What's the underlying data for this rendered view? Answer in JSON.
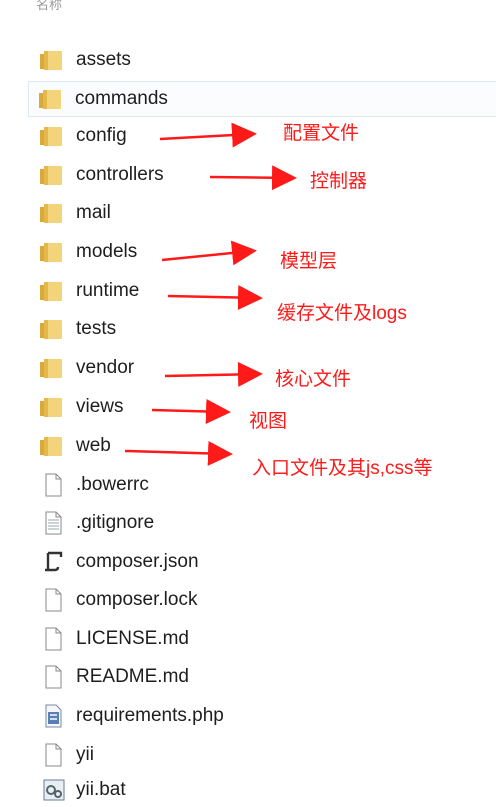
{
  "header": {
    "text": "名称"
  },
  "files": [
    {
      "name": "assets",
      "icon": "folder-icon"
    },
    {
      "name": "commands",
      "icon": "folder-icon"
    },
    {
      "name": "config",
      "icon": "folder-icon"
    },
    {
      "name": "controllers",
      "icon": "folder-icon"
    },
    {
      "name": "mail",
      "icon": "folder-icon"
    },
    {
      "name": "models",
      "icon": "folder-icon"
    },
    {
      "name": "runtime",
      "icon": "folder-icon"
    },
    {
      "name": "tests",
      "icon": "folder-icon"
    },
    {
      "name": "vendor",
      "icon": "folder-icon"
    },
    {
      "name": "views",
      "icon": "folder-icon"
    },
    {
      "name": "web",
      "icon": "folder-icon"
    },
    {
      "name": ".bowerrc",
      "icon": "blank-file-icon"
    },
    {
      "name": ".gitignore",
      "icon": "text-file-icon"
    },
    {
      "name": "composer.json",
      "icon": "script-file-icon"
    },
    {
      "name": "composer.lock",
      "icon": "blank-file-icon"
    },
    {
      "name": "LICENSE.md",
      "icon": "blank-file-icon"
    },
    {
      "name": "README.md",
      "icon": "blank-file-icon"
    },
    {
      "name": "requirements.php",
      "icon": "php-file-icon"
    },
    {
      "name": "yii",
      "icon": "blank-file-icon"
    },
    {
      "name": "yii.bat",
      "icon": "batch-file-icon"
    }
  ],
  "annotations": [
    {
      "text": "配置文件"
    },
    {
      "text": "控制器"
    },
    {
      "text": "模型层"
    },
    {
      "text": "缓存文件及logs"
    },
    {
      "text": "核心文件"
    },
    {
      "text": "视图"
    },
    {
      "text": "入口文件及其js,css等"
    }
  ],
  "colors": {
    "annotation": "#ff1a1a",
    "folder": "#e8c25a",
    "selection": "#dfe7f0"
  }
}
